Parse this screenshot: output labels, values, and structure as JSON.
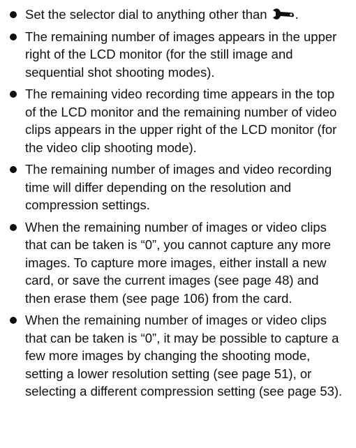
{
  "bullets": [
    {
      "text": "Set the selector dial to anything other than",
      "icon": "wrench-icon",
      "suffix": "."
    },
    {
      "text": "The remaining number of images appears in the upper right of the LCD monitor (for the still image and sequential shot shooting modes)."
    },
    {
      "text": "The remaining video recording time appears in the top of the LCD monitor and the remaining number of video clips appears in the upper right of the LCD monitor (for the video clip shooting mode)."
    },
    {
      "text": "The remaining number of images and video recording time will differ depending on the resolution and compression settings."
    },
    {
      "text": "When the remaining number of images or video clips that can be taken is “0”, you cannot capture any more images. To capture more images, either install a new card, or save the current images (see page 48) and then erase them (see page 106) from the card."
    },
    {
      "text": "When the remaining number of images or video clips that can be taken is “0”, it may be possible to capture a few more images by changing the shooting mode, setting a lower resolution setting (see page 51), or selecting a different compression setting (see page 53)."
    }
  ]
}
